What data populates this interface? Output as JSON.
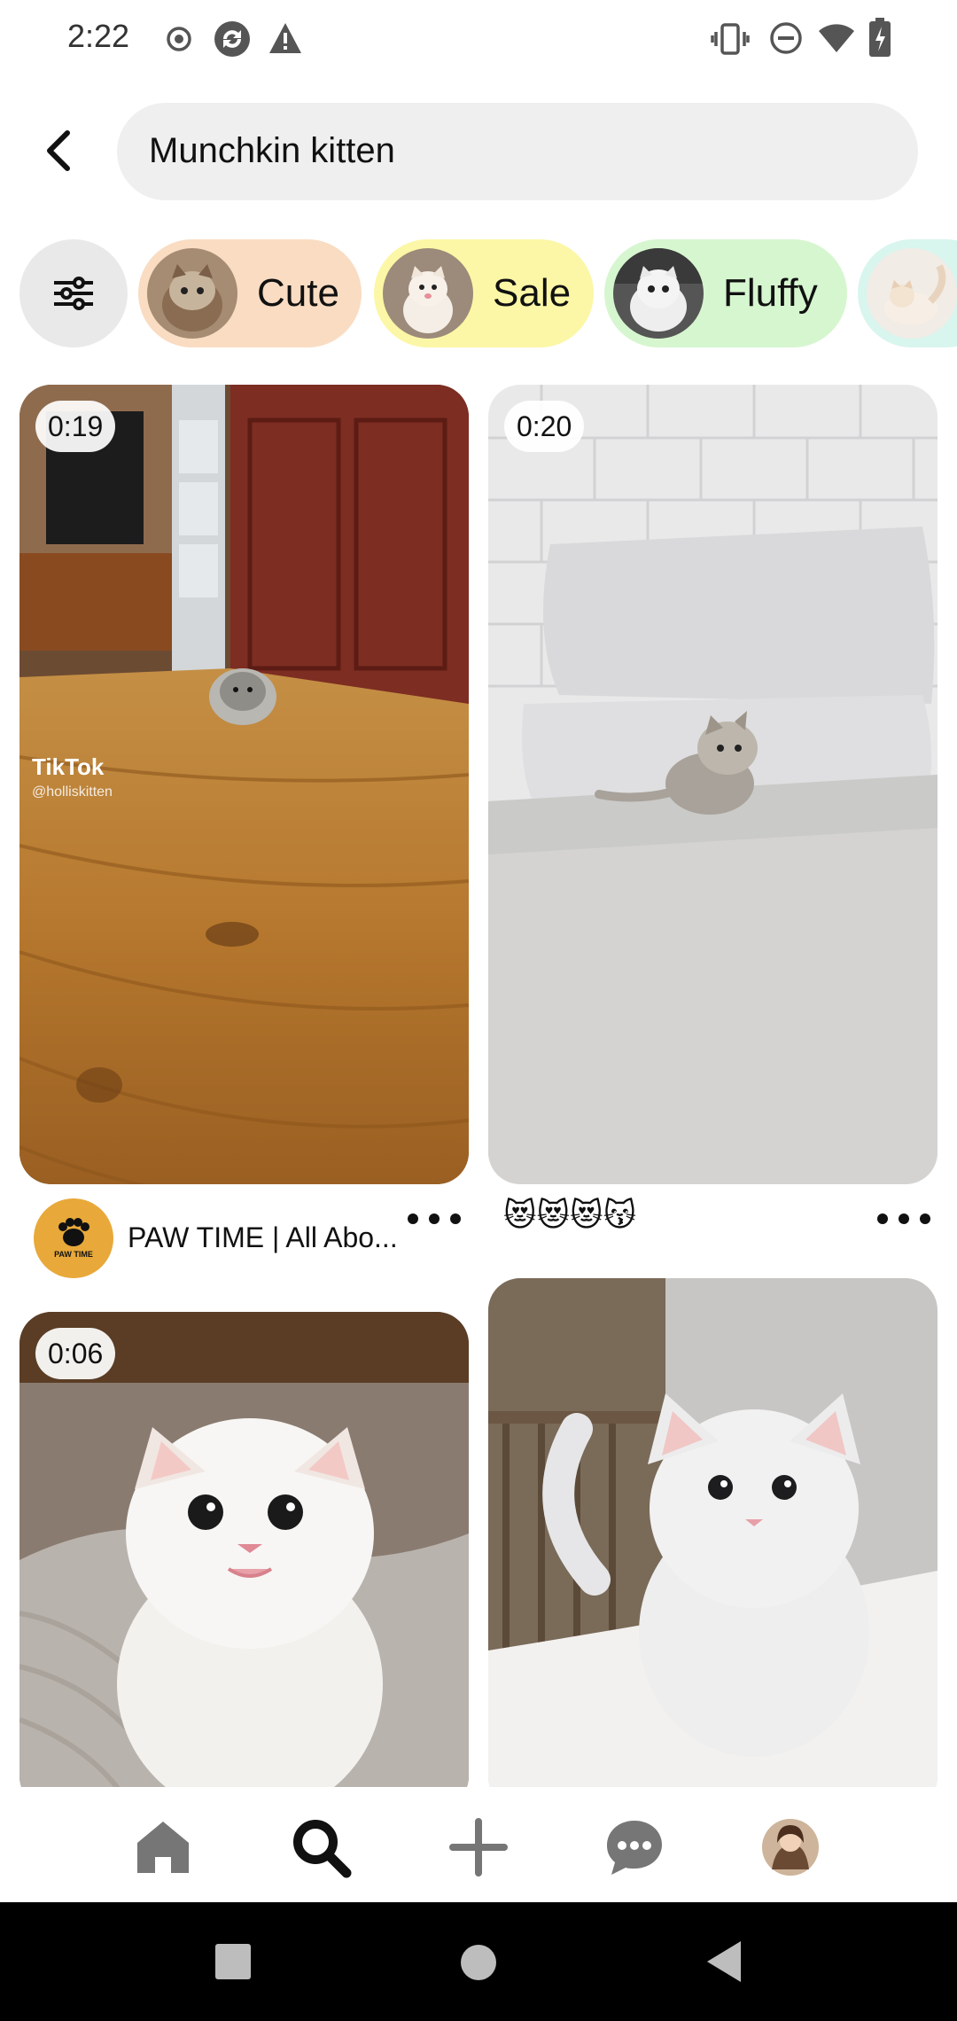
{
  "status_bar": {
    "time": "2:22"
  },
  "search": {
    "query": "Munchkin kitten"
  },
  "chips": [
    {
      "label": "Cute",
      "color": "#f9dcc2"
    },
    {
      "label": "Sale",
      "color": "#fbf7a6"
    },
    {
      "label": "Fluffy",
      "color": "#d6f6cf"
    },
    {
      "label": "",
      "color": "#d8f5ee"
    }
  ],
  "pins": [
    {
      "duration": "0:19",
      "watermark": "TikTok",
      "watermark_handle": "@holliskitten",
      "creator": "PAW TIME | All Abo...",
      "avatar_text": "PAW TIME"
    },
    {
      "duration": "0:20",
      "caption": "😻😻😻😽"
    },
    {
      "duration": "0:06"
    },
    {}
  ],
  "colors": {
    "accent_dark": "#111111",
    "chip_bg": "#e9e9e9",
    "search_bg": "#efefef"
  }
}
